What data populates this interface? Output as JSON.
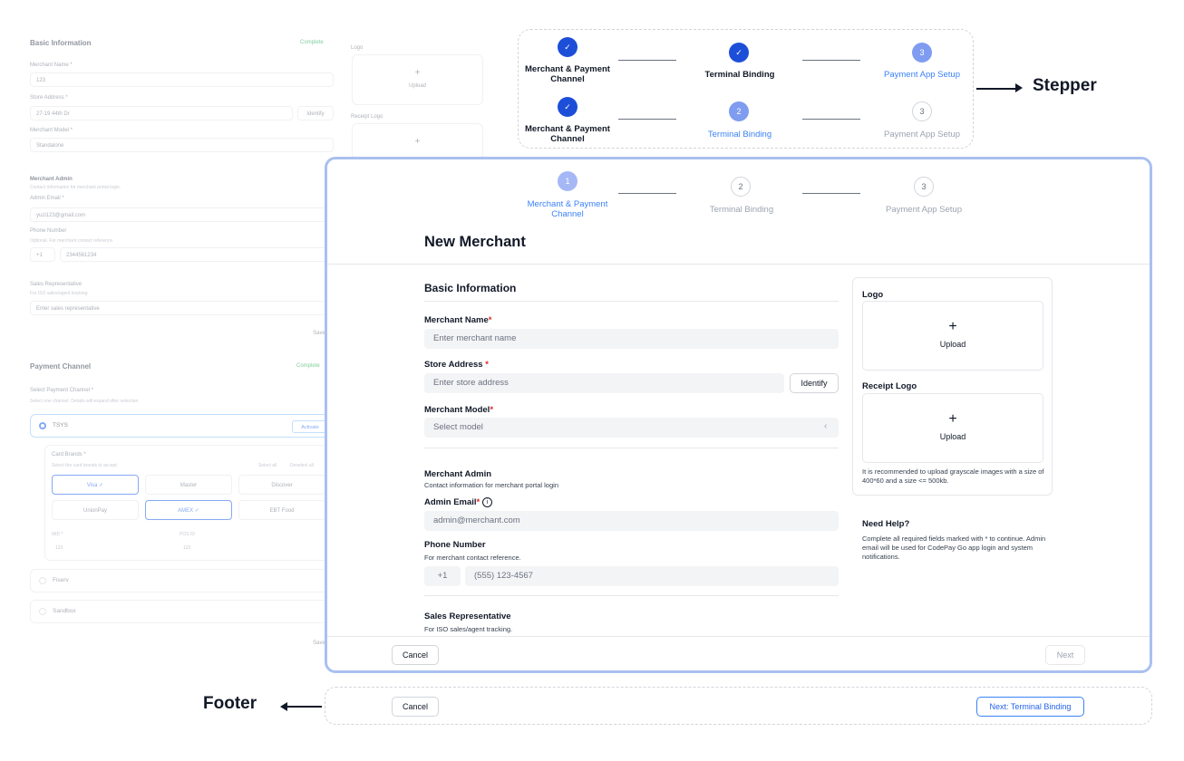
{
  "background_form": {
    "basic_title": "Basic Information",
    "basic_status": "Complete",
    "merchant_name_label": "Merchant Name *",
    "merchant_name_value": "123",
    "store_address_label": "Store Address *",
    "store_address_value": "27-19 44th Dr",
    "identify": "Identify",
    "merchant_model_label": "Merchant Model *",
    "merchant_model_value": "Standalone",
    "admin_title": "Merchant Admin",
    "admin_sub": "Contact information for merchant portal login.",
    "admin_email_label": "Admin Email *",
    "admin_email_value": "yuzi123@gmail.com",
    "phone_label": "Phone Number",
    "phone_sub": "Optional. For merchant contact reference.",
    "phone_code": "+1",
    "phone_value": "2344561234",
    "sales_title": "Sales Representative",
    "sales_sub": "For ISO sales/agent tracking.",
    "sales_placeholder": "Enter sales representative",
    "save1": "Save",
    "logo_label": "Logo",
    "upload": "Upload",
    "receipt_logo_label": "Receipt Logo",
    "payment_title": "Payment Channel",
    "payment_status": "Complete",
    "select_channel_label": "Select Payment Channel *",
    "select_channel_sub": "Select one channel. Details will expand after selection.",
    "tsys": "TSYS",
    "activate": "Activate",
    "card_brands_label": "Card Brands *",
    "card_brands_sub": "Select the card brands to accept",
    "select_all": "Select all",
    "deselect_all": "Deselect all",
    "visa": "Visa ✓",
    "master": "Master",
    "discover": "Discover",
    "unionpay": "UnionPay",
    "amex": "AMEX ✓",
    "ebt": "EBT Food",
    "mid_label": "MID *",
    "mid_value": "123",
    "pos_label": "POS ID",
    "pos_value": "123",
    "fiserv": "Fiserv",
    "sandbox": "Sandbox",
    "save2": "Save"
  },
  "stepper_callout": {
    "row1": [
      {
        "num": "✓",
        "label": "Merchant & Payment Channel"
      },
      {
        "num": "✓",
        "label": "Terminal Binding"
      },
      {
        "num": "3",
        "label": "Payment App Setup"
      }
    ],
    "row2": [
      {
        "num": "✓",
        "label": "Merchant & Payment Channel"
      },
      {
        "num": "2",
        "label": "Terminal Binding"
      },
      {
        "num": "3",
        "label": "Payment App Setup"
      }
    ]
  },
  "annotations": {
    "stepper": "Stepper",
    "footer": "Footer"
  },
  "modal": {
    "steps": [
      {
        "num": "1",
        "label": "Merchant & Payment Channel"
      },
      {
        "num": "2",
        "label": "Terminal Binding"
      },
      {
        "num": "3",
        "label": "Payment App Setup"
      }
    ],
    "title": "New Merchant",
    "basic_info": "Basic Information",
    "merchant_name_label": "Merchant Name",
    "merchant_name_placeholder": "Enter merchant name",
    "store_address_label": "Store Address",
    "store_address_placeholder": "Enter store address",
    "identify": "Identify",
    "merchant_model_label": "Merchant Model",
    "merchant_model_placeholder": "Select model",
    "required_mark": "*",
    "admin_title": "Merchant Admin",
    "admin_sub": "Contact information for merchant portal login",
    "admin_email_label": "Admin Email",
    "admin_email_placeholder": "admin@merchant.com",
    "phone_label": "Phone Number",
    "phone_sub": "For merchant contact reference.",
    "phone_code": "+1",
    "phone_placeholder": "(555) 123-4567",
    "sales_title": "Sales Representative",
    "sales_sub": "For ISO sales/agent tracking.",
    "logo_label": "Logo",
    "receipt_logo_label": "Receipt Logo",
    "upload": "Upload",
    "upload_hint": "It is recommended to upload grayscale images with a size of 400*60 and a size <= 500kb.",
    "help_title": "Need Help?",
    "help_text": "Complete all required fields marked with * to continue. Admin email will be used for CodePay Go app login and system notifications.",
    "cancel": "Cancel",
    "next": "Next"
  },
  "footer_callout": {
    "cancel": "Cancel",
    "next": "Next: Terminal Binding"
  }
}
